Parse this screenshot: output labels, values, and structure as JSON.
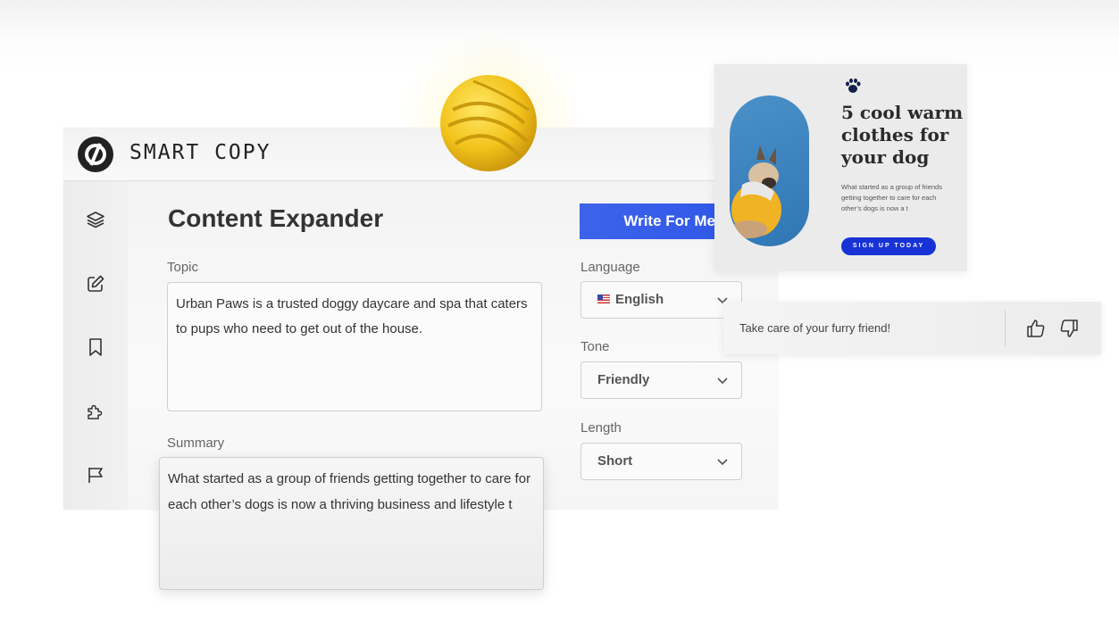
{
  "app": {
    "brand": "SMART COPY",
    "page_title": "Content Expander",
    "write_button": "Write For Me",
    "topic": {
      "label": "Topic",
      "value": "Urban Paws is a trusted doggy daycare and spa that caters to pups who need to get out of the house."
    },
    "summary": {
      "label": "Summary",
      "value": "What started as a group of friends getting together to care for each other’s dogs is now a thriving business and lifestyle t"
    },
    "language": {
      "label": "Language",
      "value": "English"
    },
    "tone": {
      "label": "Tone",
      "value": "Friendly"
    },
    "length": {
      "label": "Length",
      "value": "Short"
    },
    "sidebar_icons": [
      "layers-icon",
      "edit-icon",
      "bookmark-icon",
      "puzzle-icon",
      "flag-icon"
    ]
  },
  "promo": {
    "title": "5 cool warm clothes for your dog",
    "body": "What started as a group of friends getting together to care for each other’s dogs is now a t",
    "button": "SIGN UP TODAY"
  },
  "feedback": {
    "text": "Take care of your furry friend!"
  },
  "colors": {
    "accent": "#2f57e8",
    "promo_button": "#1733d6",
    "ball": "#f2c21b"
  }
}
